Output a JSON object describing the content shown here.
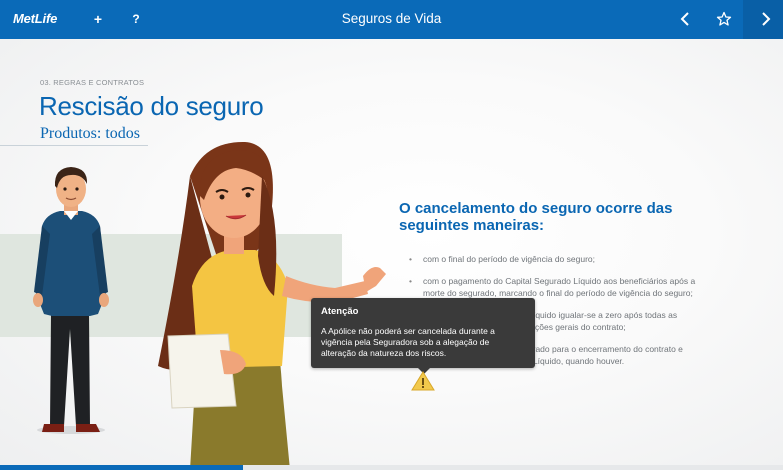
{
  "header": {
    "brand": "MetLife",
    "plus_label": "+",
    "help_label": "?",
    "title": "Seguros de Vida",
    "icons": [
      "chevron-left-icon",
      "star-icon",
      "chevron-right-icon"
    ],
    "color": "#0a6ab8"
  },
  "slide": {
    "section_label": "03. REGRAS E CONTRATOS",
    "title": "Rescisão do seguro",
    "subtitle": "Produtos: todos",
    "headline": "O cancelamento do seguro ocorre das seguintes maneiras:",
    "bullets": [
      "com o final do período de vigência do seguro;",
      "com o pagamento do Capital Segurado Líquido aos beneficiários após a morte do segurado, marcando o final do período de vigência do seguro;",
      "quando o Valor de Resgate Líquido igualar-se a zero após todas as deduções previstas nas condições gerais do contrato;",
      "mediante solicitação do segurado para o encerramento do contrato e resgate do Valor de Resgate Líquido, quando houver."
    ]
  },
  "tooltip": {
    "title": "Atenção",
    "body": "A Apólice não poderá ser cancelada durante a vigência pela Seguradora sob a alegação de alteração da natureza dos riscos."
  },
  "progress": 0.31
}
